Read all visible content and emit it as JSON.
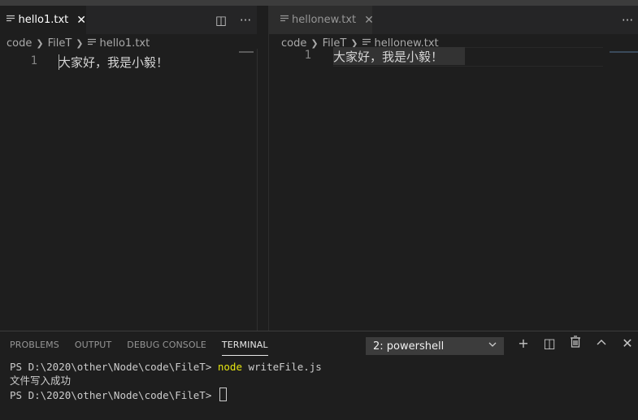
{
  "editor_left": {
    "tab": {
      "label": "hello1.txt",
      "close": "✕"
    },
    "actions": {
      "split": "◫",
      "more": "···"
    },
    "breadcrumb": [
      "code",
      "FileT",
      "hello1.txt"
    ],
    "line_number": "1",
    "line_text": "大家好，我是小毅！"
  },
  "editor_right": {
    "tab": {
      "label": "hellonew.txt",
      "close": "✕"
    },
    "actions": {
      "more": "···"
    },
    "breadcrumb": [
      "code",
      "FileT",
      "hellonew.txt"
    ],
    "line_number": "1",
    "line_text": "大家好，我是小毅！"
  },
  "panel": {
    "tabs": [
      "PROBLEMS",
      "OUTPUT",
      "DEBUG CONSOLE",
      "TERMINAL"
    ],
    "active_tab": "TERMINAL",
    "terminal_select": "2: powershell",
    "actions": {
      "add": "+",
      "split": "◫",
      "kill": "🗑",
      "maximize": "⌃",
      "close": "✕"
    }
  },
  "terminal": {
    "line1_prompt": "PS D:\\2020\\other\\Node\\code\\FileT> ",
    "line1_cmd": "node",
    "line1_args": " writeFile.js",
    "line2": "文件写入成功",
    "line3_prompt": "PS D:\\2020\\other\\Node\\code\\FileT> "
  },
  "colors": {
    "background": "#1e1e1e",
    "tabbar": "#252526",
    "command_yellow": "#e5e510"
  }
}
